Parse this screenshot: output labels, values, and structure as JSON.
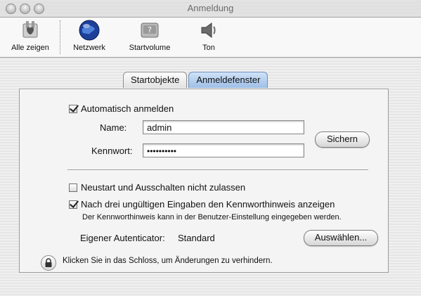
{
  "window": {
    "title": "Anmeldung"
  },
  "toolbar": {
    "items": [
      {
        "label": "Alle zeigen",
        "icon": "apple-preferences-icon"
      },
      {
        "label": "Netzwerk",
        "icon": "globe-icon"
      },
      {
        "label": "Startvolume",
        "icon": "hard-drive-icon"
      },
      {
        "label": "Ton",
        "icon": "speaker-icon"
      }
    ]
  },
  "tabs": [
    {
      "label": "Startobjekte",
      "active": false
    },
    {
      "label": "Anmeldefenster",
      "active": true
    }
  ],
  "panel": {
    "auto_login": {
      "label": "Automatisch anmelden",
      "checked": true
    },
    "name_label": "Name:",
    "name_value": "admin",
    "password_label": "Kennwort:",
    "password_value": "••••••••••",
    "save_button": "Sichern",
    "restart_option": {
      "label": "Neustart und Ausschalten nicht zulassen",
      "checked": false
    },
    "hint_option": {
      "label": "Nach drei ungültigen Eingaben den Kennworthinweis anzeigen",
      "checked": true
    },
    "hint_note": "Der Kennworthinweis kann in der Benutzer-Einstellung eingegeben werden.",
    "authenticator_label": "Eigener Autenticator:",
    "authenticator_value": "Standard",
    "choose_button": "Auswählen...",
    "lock_text": "Klicken Sie in das Schloss, um Änderungen zu verhindern."
  }
}
